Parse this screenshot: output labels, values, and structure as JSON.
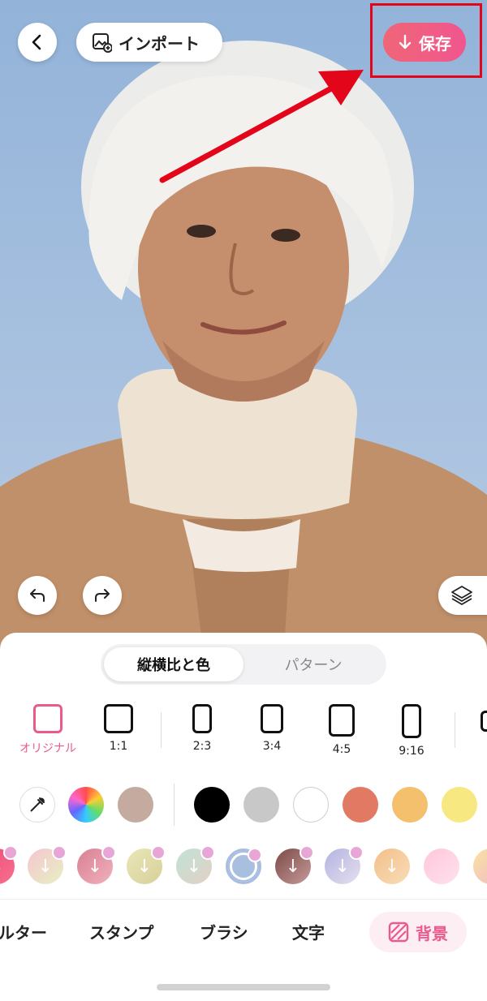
{
  "header": {
    "import_label": "インポート",
    "save_label": "保存"
  },
  "panel": {
    "segments": [
      "縦横比と色",
      "パターン"
    ],
    "ratios": [
      "オリジナル",
      "1:1",
      "2:3",
      "3:4",
      "4:5",
      "9:16"
    ],
    "swatch_colors": [
      "#c4aa9f",
      "#000000",
      "#c8c8c8",
      "#ffffff",
      "#e27a63",
      "#f4c06e",
      "#f7e882"
    ],
    "tabs": [
      "ルター",
      "スタンプ",
      "ブラシ",
      "文字",
      "背景"
    ]
  },
  "colors": {
    "accent": "#ef5a8a",
    "annotation_red": "#e3061b",
    "canvas_bg": "#9fb8d8"
  }
}
